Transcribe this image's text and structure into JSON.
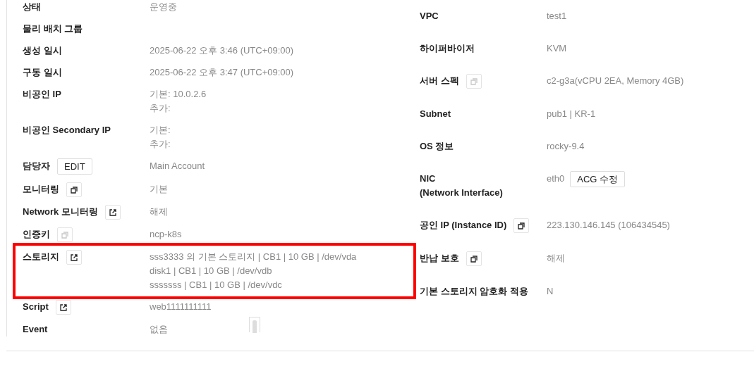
{
  "left_rows": [
    {
      "label": "상태",
      "values": [
        "운영중"
      ],
      "highlighted": false
    },
    {
      "label": "물리 배치 그룹",
      "values": [],
      "highlighted": false
    },
    {
      "label": "생성 일시",
      "values": [
        "2025-06-22 오후 3:46 (UTC+09:00)"
      ],
      "highlighted": false
    },
    {
      "label": "구동 일시",
      "values": [
        "2025-06-22 오후 3:47 (UTC+09:00)"
      ],
      "highlighted": false
    },
    {
      "label": "비공인 IP",
      "values": [
        "기본: 10.0.2.6",
        "추가:"
      ],
      "highlighted": false
    },
    {
      "label": "비공인 Secondary IP",
      "values": [
        "기본:",
        "추가:"
      ],
      "highlighted": false
    },
    {
      "label": "담당자",
      "button": "EDIT",
      "values": [
        "Main Account"
      ],
      "highlighted": false
    },
    {
      "label": "모니터링",
      "icon": {
        "kind": "copy",
        "disabled": false
      },
      "values": [
        "기본"
      ],
      "highlighted": false
    },
    {
      "label": "Network 모니터링",
      "icon": {
        "kind": "link",
        "disabled": false
      },
      "values": [
        "해제"
      ],
      "highlighted": false
    },
    {
      "label": "인증키",
      "icon": {
        "kind": "copy",
        "disabled": true
      },
      "values": [
        "ncp-k8s"
      ],
      "highlighted": false
    },
    {
      "label": "스토리지",
      "icon": {
        "kind": "link",
        "disabled": false
      },
      "values": [
        "sss3333 의 기본 스토리지 | CB1 | 10 GB | /dev/vda",
        "disk1 | CB1 | 10 GB | /dev/vdb",
        "sssssss | CB1 | 10 GB | /dev/vdc"
      ],
      "highlighted": true
    },
    {
      "label": "Script",
      "icon": {
        "kind": "link",
        "disabled": false
      },
      "values": [
        "web1111111111"
      ],
      "highlighted": false
    },
    {
      "label": "Event",
      "values": [
        "없음"
      ],
      "highlighted": false
    }
  ],
  "right_rows": [
    {
      "label": "VPC",
      "values": [
        "test1"
      ]
    },
    {
      "label": "하이퍼바이저",
      "values": [
        "KVM"
      ]
    },
    {
      "label": "서버 스펙",
      "icon": {
        "kind": "copy",
        "disabled": true
      },
      "values": [
        "c2-g3a(vCPU 2EA, Memory 4GB)"
      ]
    },
    {
      "label": "Subnet",
      "values": [
        "pub1 | KR-1"
      ]
    },
    {
      "label": "OS 정보",
      "values": [
        "rocky-9.4"
      ]
    },
    {
      "label": "NIC\n(Network Interface)",
      "values": [
        "eth0"
      ],
      "value_button": "ACG 수정"
    },
    {
      "label": "공인 IP (Instance ID)",
      "icon": {
        "kind": "copy",
        "disabled": false
      },
      "values": [
        "223.130.146.145 (106434545)"
      ]
    },
    {
      "label": "반납 보호",
      "icon": {
        "kind": "copy",
        "disabled": false
      },
      "values": [
        "해제"
      ]
    },
    {
      "label": "기본 스토리지 암호화 적용",
      "values": [
        "N"
      ]
    }
  ]
}
